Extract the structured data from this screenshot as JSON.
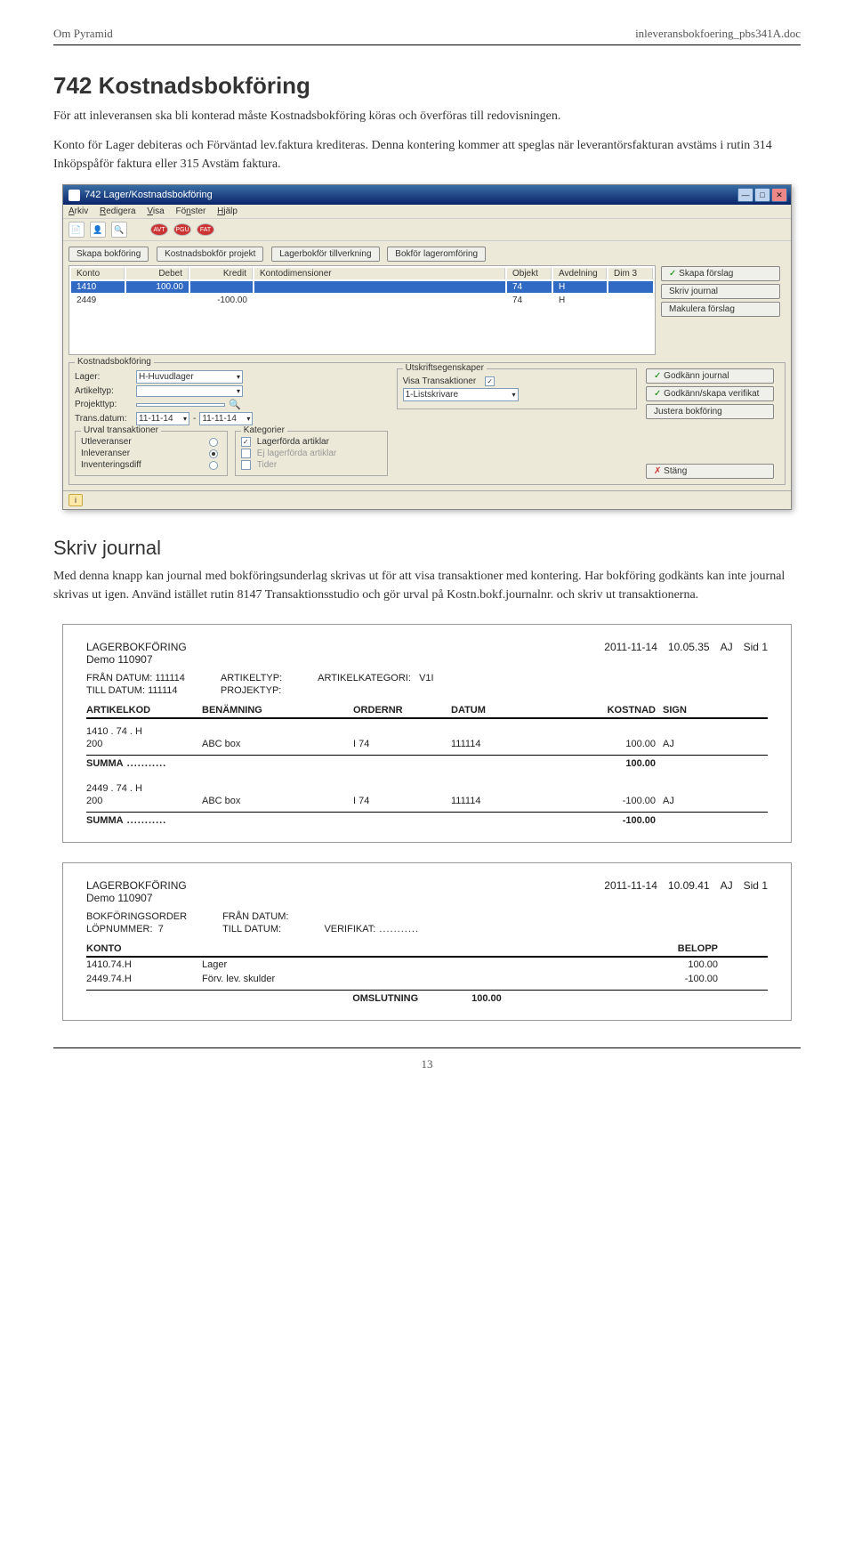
{
  "header": {
    "left": "Om Pyramid",
    "right": "inleveransbokfoering_pbs341A.doc"
  },
  "h1": "742 Kostnadsbokföring",
  "p1": "För att inleveransen ska bli konterad måste Kostnadsbokföring köras och överföras till redovisningen.",
  "p2": "Konto för Lager debiteras och Förväntad lev.faktura krediteras. Denna kontering kommer att speglas när leverantörsfakturan avstäms i rutin 314 Inköpspåför faktura eller 315 Avstäm faktura.",
  "app": {
    "title": "742 Lager/Kostnadsbokföring",
    "menu": {
      "arkiv": "Arkiv",
      "redigera": "Redigera",
      "visa": "Visa",
      "fonster": "Fönster",
      "hjalp": "Hjälp"
    },
    "toolbarIcons": [
      "doc",
      "user",
      "search",
      "AVT",
      "PGU",
      "FAT"
    ],
    "tabs": {
      "skapa": "Skapa bokföring",
      "kostnad": "Kostnadsbokför projekt",
      "lagerbok": "Lagerbokför tillverkning",
      "bokfor": "Bokför lageromföring"
    },
    "gridHeaders": {
      "konto": "Konto",
      "debet": "Debet",
      "kredit": "Kredit",
      "kontodim": "Kontodimensioner",
      "objekt": "Objekt",
      "avdelning": "Avdelning",
      "dim3": "Dim 3"
    },
    "gridRows": [
      {
        "konto": "1410",
        "debet": "100.00",
        "kredit": "",
        "objekt": "74",
        "avdelning": "H"
      },
      {
        "konto": "2449",
        "debet": "",
        "kredit": "-100.00",
        "objekt": "74",
        "avdelning": "H"
      }
    ],
    "sideBtns": {
      "skapa": "Skapa förslag",
      "skriv": "Skriv journal",
      "makulera": "Makulera förslag"
    },
    "panelTitle": "Kostnadsbokföring",
    "fields": {
      "lager_lbl": "Lager:",
      "lager_val": "H-Huvudlager",
      "artikeltyp_lbl": "Artikeltyp:",
      "projekttyp_lbl": "Projekttyp:",
      "transdatum_lbl": "Trans.datum:",
      "trans_from": "11-11-14",
      "trans_to": "11-11-14"
    },
    "utskrift": {
      "panel": "Utskriftsegenskaper",
      "visa": "Visa Transaktioner",
      "skrivare": "1-Listskrivare"
    },
    "rightBtns": {
      "godkann": "Godkänn journal",
      "godkannverif": "Godkänn/skapa verifikat",
      "justera": "Justera bokföring",
      "stang": "Stäng"
    },
    "urval": {
      "panel": "Urval transaktioner",
      "utlev": "Utleveranser",
      "inlev": "Inleveranser",
      "invdiff": "Inventeringsdiff"
    },
    "kategorier": {
      "panel": "Kategorier",
      "lagerforda": "Lagerförda artiklar",
      "ejlager": "Ej lagerförda artiklar",
      "tider": "Tider"
    }
  },
  "h2": "Skriv journal",
  "p3": "Med denna knapp kan journal med bokföringsunderlag skrivas ut för att visa transaktioner med kontering. Har bokföring godkänts kan inte journal skrivas ut igen. Använd istället rutin 8147 Transaktionsstudio och gör urval på Kostn.bokf.journalnr. och skriv ut transaktionerna.",
  "report1": {
    "title": "LAGERBOKFÖRING",
    "sub": "Demo 110907",
    "date": "2011-11-14",
    "time": "10.05.35",
    "sign": "AJ",
    "sid_lbl": "Sid",
    "sid": "1",
    "meta": {
      "fran_lbl": "FRÅN DATUM:",
      "fran": "111114",
      "till_lbl": "TILL DATUM:",
      "till": "111114",
      "artikeltyp_lbl": "ARTIKELTYP:",
      "projekttyp_lbl": "PROJEKTYP:",
      "artkat_lbl": "ARTIKELKATEGORI:",
      "artkat": "V1I"
    },
    "cols": {
      "artikelkod": "ARTIKELKOD",
      "benamning": "BENÄMNING",
      "ordernr": "ORDERNR",
      "datum": "DATUM",
      "kostnad": "KOSTNAD",
      "sign": "SIGN"
    },
    "group1": "1410 . 74 . H",
    "row1": {
      "art": "200",
      "ben": "ABC box",
      "ord": "I   74",
      "dat": "111114",
      "kost": "100.00",
      "sign": "AJ"
    },
    "sum_lbl": "SUMMA",
    "sum1": "100.00",
    "group2": "2449 . 74 . H",
    "row2": {
      "art": "200",
      "ben": "ABC box",
      "ord": "I   74",
      "dat": "111114",
      "kost": "-100.00",
      "sign": "AJ"
    },
    "sum2": "-100.00"
  },
  "report2": {
    "title": "LAGERBOKFÖRING",
    "sub": "Demo 110907",
    "date": "2011-11-14",
    "time": "10.09.41",
    "sign": "AJ",
    "sid_lbl": "Sid",
    "sid": "1",
    "meta": {
      "bokorder_lbl": "BOKFÖRINGSORDER",
      "lopnr_lbl": "LÖPNUMMER:",
      "lopnr": "7",
      "fran_lbl": "FRÅN DATUM:",
      "till_lbl": "TILL DATUM:",
      "verifikat_lbl": "VERIFIKAT:"
    },
    "cols": {
      "konto": "KONTO",
      "belopp": "BELOPP"
    },
    "rows": [
      {
        "konto": "1410.74.H",
        "txt": "Lager",
        "belopp": "100.00"
      },
      {
        "konto": "2449.74.H",
        "txt": "Förv. lev. skulder",
        "belopp": "-100.00"
      }
    ],
    "oms_lbl": "OMSLUTNING",
    "oms": "100.00"
  },
  "pagenum": "13"
}
